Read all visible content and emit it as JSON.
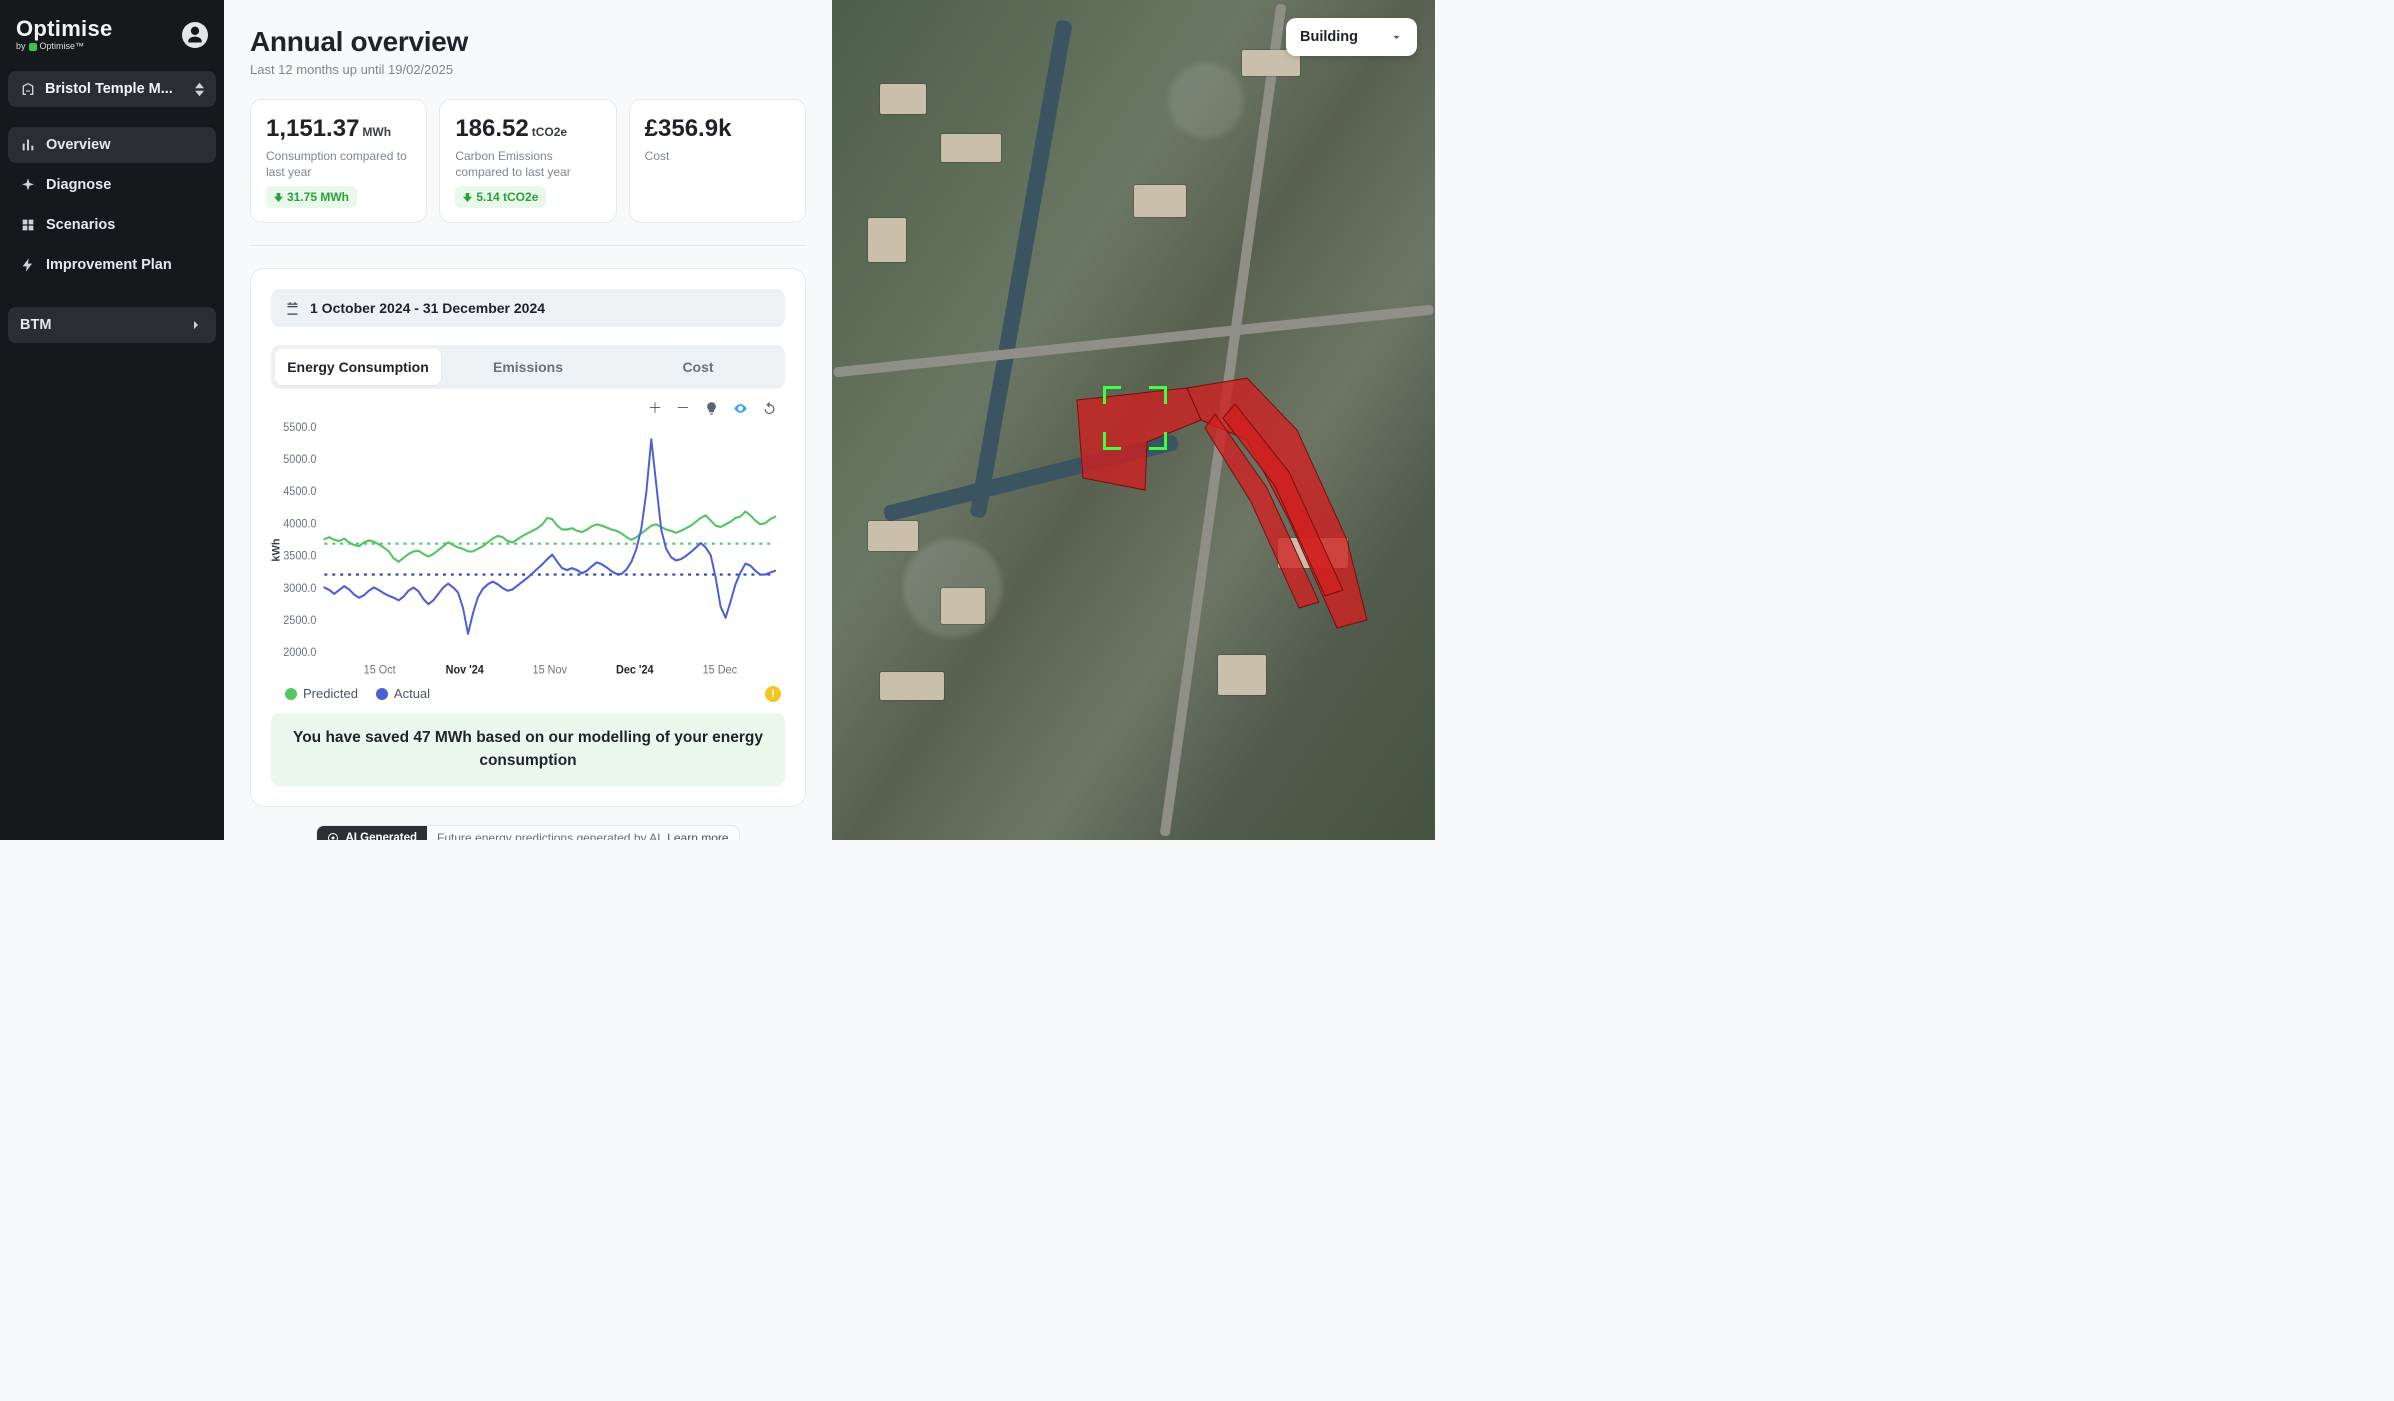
{
  "brand": {
    "name": "Optimise",
    "subline": "by",
    "subbrand": "Optimise™"
  },
  "site_selector": {
    "label": "Bristol Temple M..."
  },
  "nav": [
    {
      "key": "overview",
      "label": "Overview"
    },
    {
      "key": "diagnose",
      "label": "Diagnose"
    },
    {
      "key": "scenarios",
      "label": "Scenarios"
    },
    {
      "key": "improvement",
      "label": "Improvement Plan"
    }
  ],
  "nav2": {
    "label": "BTM"
  },
  "header": {
    "title": "Annual overview",
    "subtitle": "Last 12 months up until 19/02/2025"
  },
  "kpis": {
    "consumption": {
      "value": "1,151.37",
      "unit": "MWh",
      "desc": "Consumption compared to last year",
      "delta": "31.75 MWh"
    },
    "emissions": {
      "value": "186.52",
      "unit": "tCO2e",
      "desc": "Carbon Emissions compared to last year",
      "delta": "5.14 tCO2e"
    },
    "cost": {
      "value": "£356.9k",
      "desc": "Cost"
    }
  },
  "chart_card": {
    "range": "1 October 2024 - 31 December 2024",
    "tabs": [
      "Energy Consumption",
      "Emissions",
      "Cost"
    ],
    "legend": {
      "predicted": "Predicted",
      "actual": "Actual"
    },
    "savings": "You have saved 47 MWh based on our modelling of your energy consumption"
  },
  "ai": {
    "badge": "AI Generated",
    "text": "Future energy predictions generated by AI. ",
    "link": "Learn more"
  },
  "map": {
    "selector": "Building"
  },
  "chart_data": {
    "type": "line",
    "ylabel": "kWh",
    "ylim": [
      2000,
      5500
    ],
    "yticks": [
      2000,
      2500,
      3000,
      3500,
      4000,
      4500,
      5000,
      5500
    ],
    "reference": {
      "predicted": 3680,
      "actual": 3200
    },
    "xticks": [
      {
        "label": "15 Oct",
        "bold": false
      },
      {
        "label": "Nov '24",
        "bold": true
      },
      {
        "label": "15 Nov",
        "bold": false
      },
      {
        "label": "Dec '24",
        "bold": true
      },
      {
        "label": "15 Dec",
        "bold": false
      }
    ],
    "n": 92,
    "series": [
      {
        "name": "Predicted",
        "color": "#54c564",
        "values": [
          3750,
          3780,
          3740,
          3720,
          3760,
          3700,
          3660,
          3640,
          3700,
          3730,
          3710,
          3670,
          3620,
          3560,
          3450,
          3400,
          3460,
          3520,
          3560,
          3570,
          3520,
          3480,
          3520,
          3580,
          3640,
          3700,
          3660,
          3620,
          3600,
          3560,
          3560,
          3600,
          3640,
          3700,
          3760,
          3800,
          3780,
          3720,
          3700,
          3750,
          3800,
          3840,
          3880,
          3920,
          3980,
          4080,
          4060,
          3960,
          3900,
          3900,
          3920,
          3880,
          3860,
          3900,
          3950,
          3980,
          3960,
          3930,
          3900,
          3880,
          3840,
          3780,
          3740,
          3780,
          3840,
          3900,
          3960,
          3980,
          3940,
          3900,
          3880,
          3850,
          3880,
          3920,
          3960,
          4020,
          4080,
          4120,
          4040,
          3960,
          3940,
          3980,
          4020,
          4080,
          4100,
          4180,
          4120,
          4040,
          3980,
          4000,
          4060,
          4100
        ]
      },
      {
        "name": "Actual",
        "color": "#4c5fd6",
        "values": [
          3000,
          2960,
          2900,
          2960,
          3020,
          2970,
          2890,
          2840,
          2880,
          2950,
          3000,
          2960,
          2910,
          2870,
          2840,
          2800,
          2860,
          2950,
          3000,
          2940,
          2820,
          2740,
          2800,
          2900,
          3000,
          3060,
          3000,
          2920,
          2680,
          2280,
          2600,
          2850,
          2980,
          3050,
          3090,
          3050,
          2990,
          2950,
          2970,
          3030,
          3090,
          3150,
          3220,
          3290,
          3360,
          3440,
          3510,
          3400,
          3300,
          3270,
          3300,
          3270,
          3220,
          3260,
          3330,
          3390,
          3360,
          3310,
          3250,
          3210,
          3210,
          3280,
          3400,
          3600,
          3920,
          4480,
          5300,
          4600,
          3900,
          3600,
          3470,
          3420,
          3440,
          3490,
          3550,
          3620,
          3690,
          3620,
          3500,
          3150,
          2700,
          2530,
          2780,
          3050,
          3230,
          3370,
          3340,
          3260,
          3200,
          3200,
          3230,
          3260
        ]
      }
    ]
  }
}
